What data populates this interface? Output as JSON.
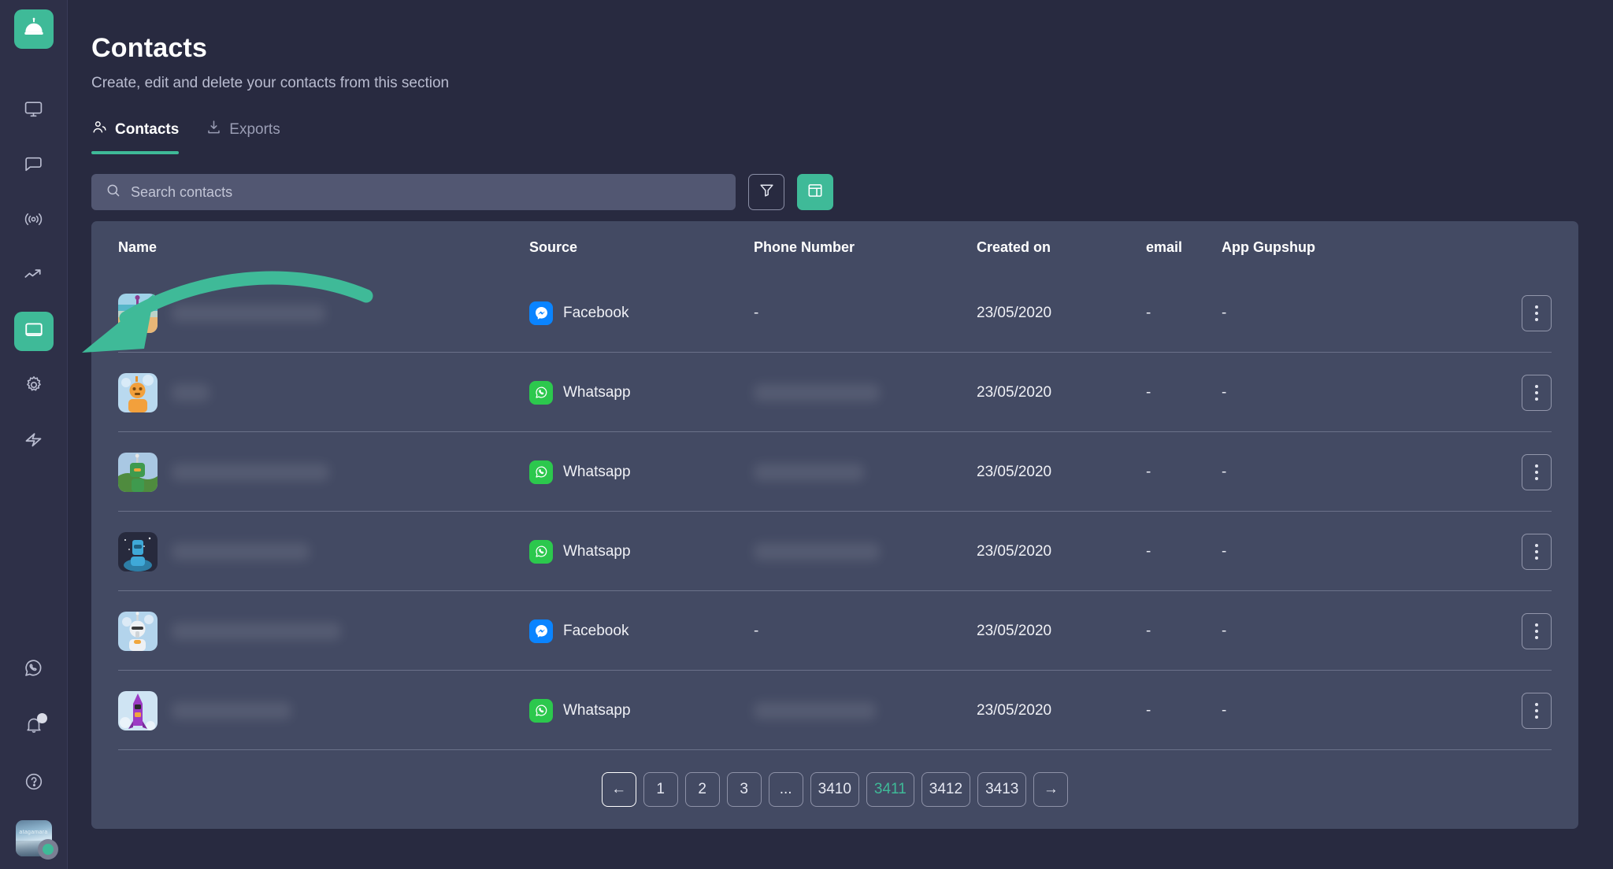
{
  "sidebar": {
    "logo": {
      "icon": "service-bell-icon"
    },
    "items": [
      {
        "name": "monitor",
        "icon": "monitor-icon",
        "active": false
      },
      {
        "name": "chat",
        "icon": "chat-bubble-icon",
        "active": false
      },
      {
        "name": "broadcast",
        "icon": "broadcast-icon",
        "active": false
      },
      {
        "name": "analytics",
        "icon": "trend-up-icon",
        "active": false
      },
      {
        "name": "contacts",
        "icon": "contacts-board-icon",
        "active": true
      },
      {
        "name": "settings",
        "icon": "gear-icon",
        "active": false
      },
      {
        "name": "automation",
        "icon": "lightning-icon",
        "active": false
      }
    ],
    "bottom_items": [
      {
        "name": "whatsapp",
        "icon": "whatsapp-icon"
      },
      {
        "name": "notifications",
        "icon": "bell-icon",
        "badge": true
      },
      {
        "name": "help",
        "icon": "help-circle-icon"
      }
    ],
    "user": {
      "name": "user-avatar",
      "label": "atagamara",
      "status": "online"
    }
  },
  "header": {
    "title": "Contacts",
    "subtitle": "Create, edit and delete your contacts from this section"
  },
  "tabs": [
    {
      "label": "Contacts",
      "icon": "people-icon",
      "active": true
    },
    {
      "label": "Exports",
      "icon": "download-icon",
      "active": false
    }
  ],
  "toolbar": {
    "search": {
      "placeholder": "Search contacts",
      "value": "",
      "icon": "search-icon"
    },
    "filter_button": {
      "icon": "funnel-icon",
      "label": ""
    },
    "columns_button": {
      "icon": "table-grid-icon",
      "label": ""
    }
  },
  "table": {
    "columns": [
      "Name",
      "Source",
      "Phone Number",
      "Created on",
      "email",
      "App Gupshup"
    ],
    "rows": [
      {
        "name": "",
        "name_redacted": true,
        "avatar": "robot-purple-beach",
        "source": "Facebook",
        "source_icon": "messenger-icon",
        "phone": "-",
        "phone_redacted": false,
        "created_on": "23/05/2020",
        "email": "-",
        "app_gupshup": "-"
      },
      {
        "name": "",
        "name_redacted": true,
        "avatar": "robot-orange-sky",
        "source": "Whatsapp",
        "source_icon": "whatsapp-icon",
        "phone": "",
        "phone_redacted": true,
        "created_on": "23/05/2020",
        "email": "-",
        "app_gupshup": "-"
      },
      {
        "name": "",
        "name_redacted": true,
        "avatar": "robot-green-hills",
        "source": "Whatsapp",
        "source_icon": "whatsapp-icon",
        "phone": "",
        "phone_redacted": true,
        "created_on": "23/05/2020",
        "email": "-",
        "app_gupshup": "-"
      },
      {
        "name": "",
        "name_redacted": true,
        "avatar": "robot-blue-space",
        "source": "Whatsapp",
        "source_icon": "whatsapp-icon",
        "phone": "",
        "phone_redacted": true,
        "created_on": "23/05/2020",
        "email": "-",
        "app_gupshup": "-"
      },
      {
        "name": "",
        "name_redacted": true,
        "avatar": "robot-white-clouds",
        "source": "Facebook",
        "source_icon": "messenger-icon",
        "phone": "-",
        "phone_redacted": false,
        "created_on": "23/05/2020",
        "email": "-",
        "app_gupshup": "-"
      },
      {
        "name": "",
        "name_redacted": true,
        "avatar": "robot-magenta-rocket",
        "source": "Whatsapp",
        "source_icon": "whatsapp-icon",
        "phone": "",
        "phone_redacted": true,
        "created_on": "23/05/2020",
        "email": "-",
        "app_gupshup": "-"
      }
    ],
    "row_action_icon": "kebab-menu-icon"
  },
  "pagination": {
    "prev_label": "←",
    "next_label": "→",
    "pages": [
      "1",
      "2",
      "3",
      "...",
      "3410",
      "3411",
      "3412",
      "3413"
    ],
    "current": "3411"
  },
  "annotation": {
    "type": "curved-arrow",
    "color": "#3fba98",
    "points_to": "first-contact-row"
  },
  "colors": {
    "accent": "#3fba98",
    "page_bg": "#282a40",
    "sidebar_bg": "#2e3048",
    "table_bg": "#434a63",
    "search_bg": "#525772",
    "whatsapp_green": "#2cc84d",
    "messenger_blue": "#0a84ff"
  }
}
